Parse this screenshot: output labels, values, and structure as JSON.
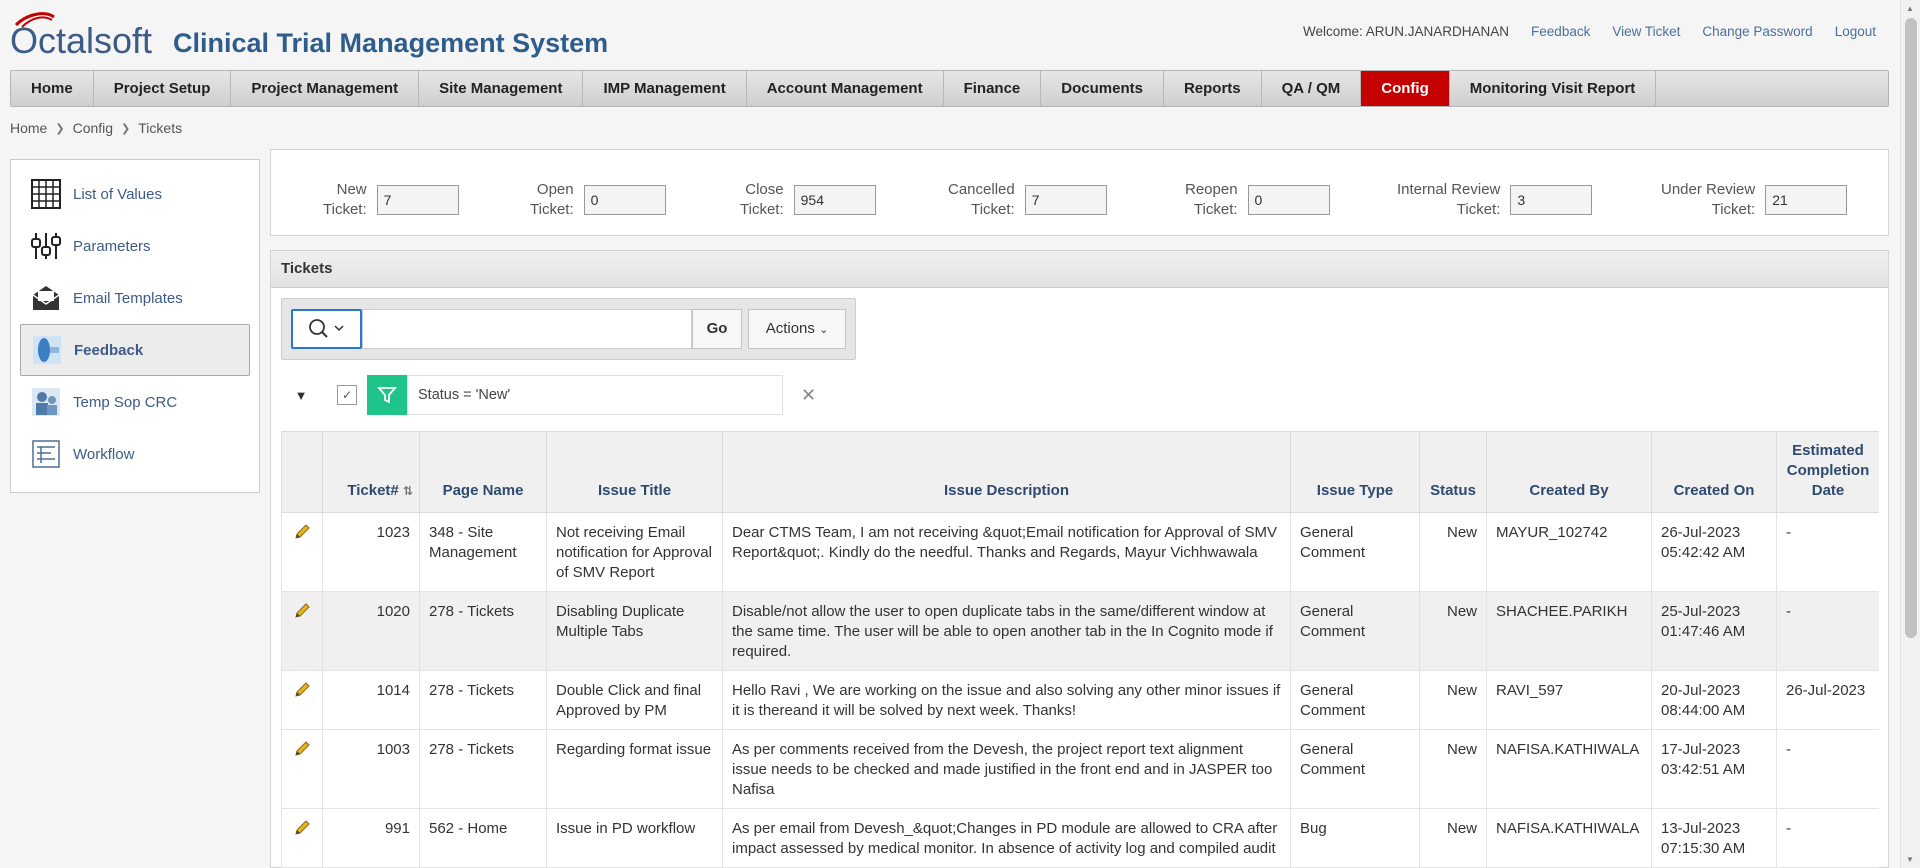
{
  "header": {
    "logo_text": "Octalsoft",
    "app_title": "Clinical Trial Management System",
    "welcome": "Welcome: ARUN.JANARDHANAN",
    "links": [
      "Feedback",
      "View Ticket",
      "Change Password",
      "Logout"
    ]
  },
  "nav": {
    "items": [
      "Home",
      "Project Setup",
      "Project Management",
      "Site Management",
      "IMP Management",
      "Account Management",
      "Finance",
      "Documents",
      "Reports",
      "QA / QM",
      "Config",
      "Monitoring Visit Report"
    ],
    "active": "Config"
  },
  "breadcrumb": [
    "Home",
    "Config",
    "Tickets"
  ],
  "sidebar": {
    "items": [
      {
        "label": "List of Values",
        "icon": "grid-icon"
      },
      {
        "label": "Parameters",
        "icon": "sliders-icon"
      },
      {
        "label": "Email Templates",
        "icon": "envelope-icon"
      },
      {
        "label": "Feedback",
        "icon": "feedback-icon"
      },
      {
        "label": "Temp Sop CRC",
        "icon": "people-icon"
      },
      {
        "label": "Workflow",
        "icon": "workflow-icon"
      }
    ],
    "active": "Feedback"
  },
  "counters": [
    {
      "label1": "New",
      "label2": "Ticket:",
      "value": "7"
    },
    {
      "label1": "Open",
      "label2": "Ticket:",
      "value": "0"
    },
    {
      "label1": "Close",
      "label2": "Ticket:",
      "value": "954"
    },
    {
      "label1": "Cancelled",
      "label2": "Ticket:",
      "value": "7"
    },
    {
      "label1": "Reopen",
      "label2": "Ticket:",
      "value": "0"
    },
    {
      "label1": "Internal Review",
      "label2": "Ticket:",
      "value": "3"
    },
    {
      "label1": "Under Review",
      "label2": "Ticket:",
      "value": "21"
    }
  ],
  "region": {
    "title": "Tickets",
    "go_label": "Go",
    "actions_label": "Actions",
    "search_value": "",
    "filter_text": "Status = 'New'"
  },
  "table": {
    "headers": [
      "Ticket#",
      "Page Name",
      "Issue Title",
      "Issue Description",
      "Issue Type",
      "Status",
      "Created By",
      "Created On",
      "Estimated Completion Date"
    ],
    "rows": [
      {
        "ticket": "1023",
        "page": "348 - Site Management",
        "title": "Not receiving Email notification for Approval of SMV Report",
        "desc": "Dear CTMS Team, I am not receiving &quot;Email notification for Approval of SMV Report&quot;. Kindly do the needful. Thanks and Regards, Mayur Vichhwawala",
        "type": "General Comment",
        "status": "New",
        "by": "MAYUR_102742",
        "on": "26-Jul-2023 05:42:42 AM",
        "ecd": "-"
      },
      {
        "ticket": "1020",
        "page": "278 - Tickets",
        "title": "Disabling Duplicate Multiple Tabs",
        "desc": "Disable/not allow the user to open duplicate tabs in the same/different window at the same time. The user will be able to open another tab in the In Cognito mode if required.",
        "type": "General Comment",
        "status": "New",
        "by": "SHACHEE.PARIKH",
        "on": "25-Jul-2023 01:47:46 AM",
        "ecd": "-"
      },
      {
        "ticket": "1014",
        "page": "278 - Tickets",
        "title": "Double Click and final Approved by PM",
        "desc": "Hello Ravi , We are working on the issue and also solving any other minor issues if it is thereand it will be solved by next week. Thanks!",
        "type": "General Comment",
        "status": "New",
        "by": "RAVI_597",
        "on": "20-Jul-2023 08:44:00 AM",
        "ecd": "26-Jul-2023"
      },
      {
        "ticket": "1003",
        "page": "278 - Tickets",
        "title": "Regarding format issue",
        "desc": "As per comments received from the Devesh, the project report text alignment issue needs to be checked and made justified in the front end and in JASPER too Nafisa",
        "type": "General Comment",
        "status": "New",
        "by": "NAFISA.KATHIWALA",
        "on": "17-Jul-2023 03:42:51 AM",
        "ecd": "-"
      },
      {
        "ticket": "991",
        "page": "562 - Home",
        "title": "Issue in PD workflow",
        "desc": "As per email from Devesh_&quot;Changes in PD module are allowed to CRA after impact assessed by medical monitor. In absence of activity log and compiled audit",
        "type": "Bug",
        "status": "New",
        "by": "NAFISA.KATHIWALA",
        "on": "13-Jul-2023 07:15:30 AM",
        "ecd": "-"
      }
    ]
  },
  "colors": {
    "accent": "#c40000",
    "link": "#3c5b87",
    "filter": "#1fc48a",
    "focus": "#2a78d6"
  }
}
